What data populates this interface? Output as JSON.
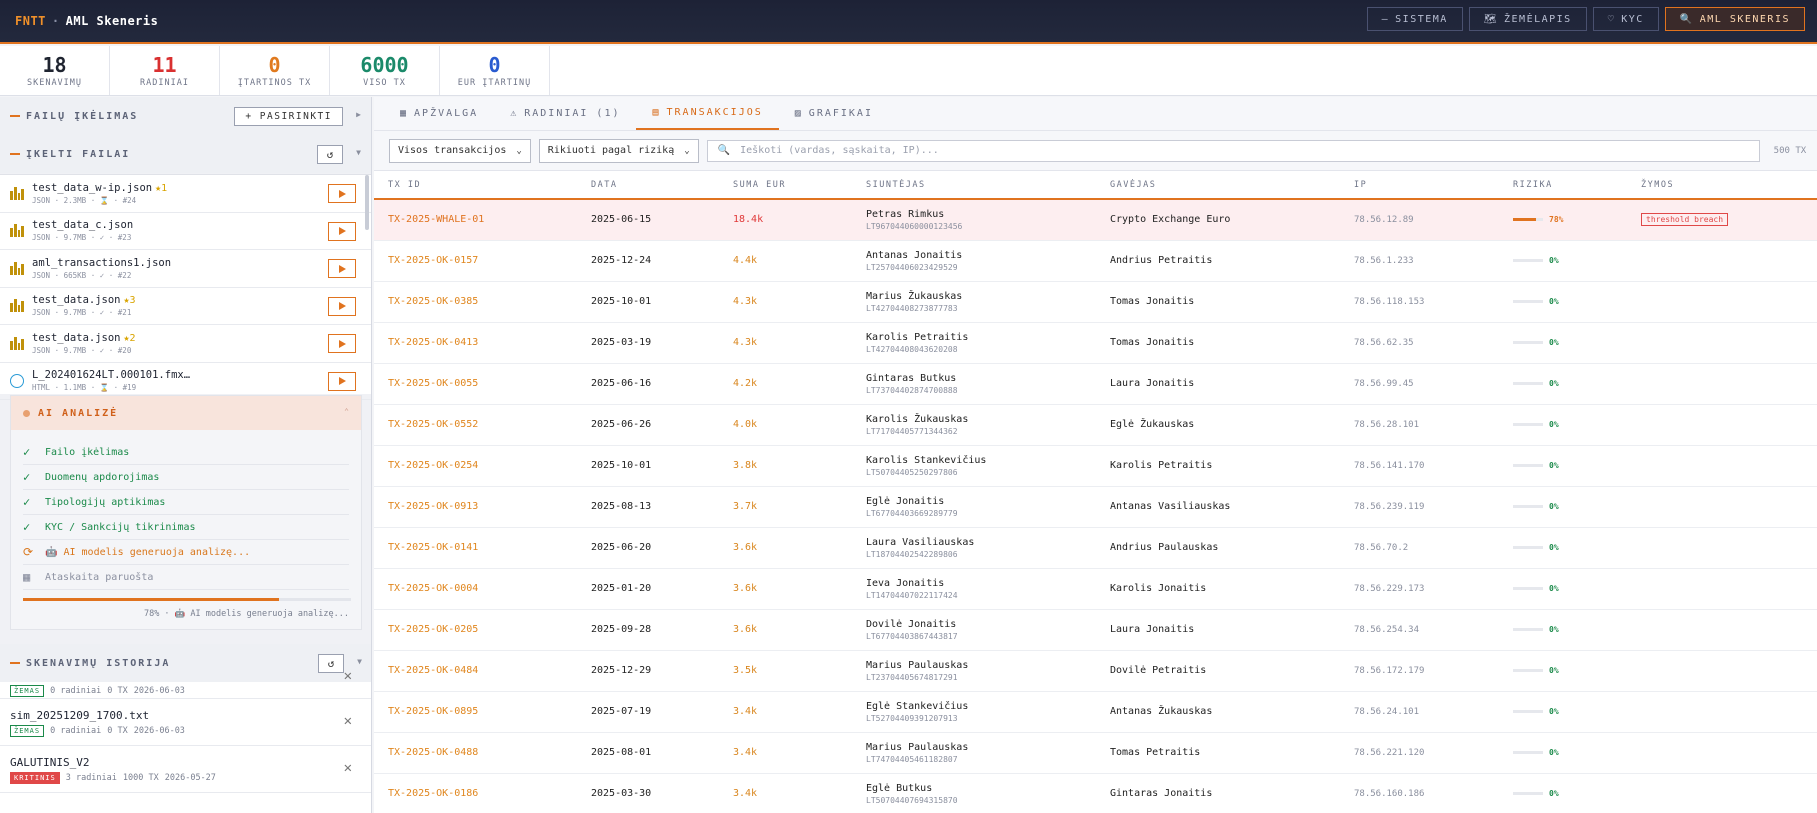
{
  "header": {
    "brand_code": "FNTT",
    "brand_sep": "·",
    "brand_title": "AML Skeneris",
    "nav": [
      {
        "icon": "—",
        "label": "SISTEMA"
      },
      {
        "icon": "🗺",
        "label": "ŽEMĖLAPIS"
      },
      {
        "icon": "♡",
        "label": "KYC"
      },
      {
        "icon": "🔍",
        "label": "AML SKENERIS"
      }
    ]
  },
  "stats": [
    {
      "value": "18",
      "label": "SKENAVIMŲ",
      "color": "#1f2430"
    },
    {
      "value": "11",
      "label": "RADINIAI",
      "color": "#d93030"
    },
    {
      "value": "0",
      "label": "ĮTARTINOS TX",
      "color": "#e07a1f"
    },
    {
      "value": "6000",
      "label": "VISO TX",
      "color": "#1b8a6a"
    },
    {
      "value": "0",
      "label": "EUR ĮTARTINŲ",
      "color": "#2a5bd0"
    }
  ],
  "left": {
    "upload_title": "FAILŲ ĮKĖLIMAS",
    "upload_button": "+ PASIRINKTI",
    "files_title": "ĮKELTI FAILAI",
    "refresh_icon": "↺",
    "files": [
      {
        "name": "test_data_w-ip.json",
        "star": "★1",
        "meta": "JSON · 2.3MB · ⌛ · #24",
        "icon": "bars"
      },
      {
        "name": "test_data_c.json",
        "star": "",
        "meta": "JSON · 9.7MB · ✓ · #23",
        "icon": "bars"
      },
      {
        "name": "aml_transactions1.json",
        "star": "",
        "meta": "JSON · 665KB · ✓ · #22",
        "icon": "bars"
      },
      {
        "name": "test_data.json",
        "star": "★3",
        "meta": "JSON · 9.7MB · ✓ · #21",
        "icon": "bars"
      },
      {
        "name": "test_data.json",
        "star": "★2",
        "meta": "JSON · 9.7MB · ✓ · #20",
        "icon": "bars"
      },
      {
        "name": "L_202401624LT.000101.fmx…",
        "star": "",
        "meta": "HTML · 1.1MB · ⌛ · #19",
        "icon": "globe"
      }
    ],
    "ai": {
      "title": "AI ANALIZĖ",
      "caret": "⌃",
      "steps": [
        {
          "icon": "✓",
          "label": "Failo įkėlimas",
          "state": "done"
        },
        {
          "icon": "✓",
          "label": "Duomenų apdorojimas",
          "state": "done"
        },
        {
          "icon": "✓",
          "label": "Tipologijų aptikimas",
          "state": "done"
        },
        {
          "icon": "✓",
          "label": "KYC / Sankcijų tikrinimas",
          "state": "done"
        },
        {
          "icon": "⟳",
          "label": "🤖 AI modelis generuoja analizę...",
          "state": "active"
        },
        {
          "icon": "▦",
          "label": "Ataskaita paruošta",
          "state": "pending"
        }
      ],
      "progress": 0.78,
      "progress_text": "78% · 🤖 AI modelis generuoja analizę..."
    },
    "history_title": "SKENAVIMŲ ISTORIJA",
    "history": [
      {
        "name": "",
        "badge": "ŽEMAS",
        "level": "low",
        "findings": "0 radiniai",
        "tx": "0 TX",
        "date": "2026-06-03"
      },
      {
        "name": "sim_20251209_1700.txt",
        "badge": "ŽEMAS",
        "level": "low",
        "findings": "0 radiniai",
        "tx": "0 TX",
        "date": "2026-06-03"
      },
      {
        "name": "GALUTINIS_V2",
        "badge": "KRITINIS",
        "level": "crit",
        "findings": "3 radiniai",
        "tx": "1000 TX",
        "date": "2026-05-27"
      }
    ]
  },
  "tabs": [
    {
      "icon": "▦",
      "label": "APŽVALGA",
      "active": false
    },
    {
      "icon": "⚠",
      "label": "RADINIAI (1)",
      "active": false
    },
    {
      "icon": "▤",
      "label": "TRANSAKCIJOS",
      "active": true
    },
    {
      "icon": "▨",
      "label": "GRAFIKAI",
      "active": false
    }
  ],
  "filters": {
    "type_select": "Visos transakcijos",
    "sort_select": "Rikiuoti pagal riziką",
    "search_placeholder": "Ieškoti (vardas, sąskaita, IP)...",
    "count": "500 TX"
  },
  "table": {
    "headers": [
      "TX ID",
      "DATA",
      "SUMA EUR",
      "SIUNTĖJAS",
      "GAVĖJAS",
      "IP",
      "RIZIKA",
      "ŽYMOS"
    ],
    "rows": [
      {
        "id": "TX-2025-WHALE-01",
        "date": "2025-06-15",
        "amount": "18.4k",
        "sender": "Petras Rimkus",
        "account": "LT967044060000123456",
        "receiver": "Crypto Exchange Euro",
        "ip": "78.56.12.89",
        "risk": 0.78,
        "risk_label": "78%",
        "tag": "threshold breach"
      },
      {
        "id": "TX-2025-OK-0157",
        "date": "2025-12-24",
        "amount": "4.4k",
        "sender": "Antanas Jonaitis",
        "account": "LT25704406023429529",
        "receiver": "Andrius Petraitis",
        "ip": "78.56.1.233",
        "risk": 0,
        "risk_label": "0%",
        "tag": ""
      },
      {
        "id": "TX-2025-OK-0385",
        "date": "2025-10-01",
        "amount": "4.3k",
        "sender": "Marius Žukauskas",
        "account": "LT42704408273877783",
        "receiver": "Tomas Jonaitis",
        "ip": "78.56.118.153",
        "risk": 0,
        "risk_label": "0%",
        "tag": ""
      },
      {
        "id": "TX-2025-OK-0413",
        "date": "2025-03-19",
        "amount": "4.3k",
        "sender": "Karolis Petraitis",
        "account": "LT42704408043620208",
        "receiver": "Tomas Jonaitis",
        "ip": "78.56.62.35",
        "risk": 0,
        "risk_label": "0%",
        "tag": ""
      },
      {
        "id": "TX-2025-OK-0055",
        "date": "2025-06-16",
        "amount": "4.2k",
        "sender": "Gintaras Butkus",
        "account": "LT73704402874700888",
        "receiver": "Laura Jonaitis",
        "ip": "78.56.99.45",
        "risk": 0,
        "risk_label": "0%",
        "tag": ""
      },
      {
        "id": "TX-2025-OK-0552",
        "date": "2025-06-26",
        "amount": "4.0k",
        "sender": "Karolis Žukauskas",
        "account": "LT71704405771344362",
        "receiver": "Eglė Žukauskas",
        "ip": "78.56.28.101",
        "risk": 0,
        "risk_label": "0%",
        "tag": ""
      },
      {
        "id": "TX-2025-OK-0254",
        "date": "2025-10-01",
        "amount": "3.8k",
        "sender": "Karolis Stankevičius",
        "account": "LT50704405250297806",
        "receiver": "Karolis Petraitis",
        "ip": "78.56.141.170",
        "risk": 0,
        "risk_label": "0%",
        "tag": ""
      },
      {
        "id": "TX-2025-OK-0913",
        "date": "2025-08-13",
        "amount": "3.7k",
        "sender": "Eglė Jonaitis",
        "account": "LT67704403669289779",
        "receiver": "Antanas Vasiliauskas",
        "ip": "78.56.239.119",
        "risk": 0,
        "risk_label": "0%",
        "tag": ""
      },
      {
        "id": "TX-2025-OK-0141",
        "date": "2025-06-20",
        "amount": "3.6k",
        "sender": "Laura Vasiliauskas",
        "account": "LT18704402542289806",
        "receiver": "Andrius Paulauskas",
        "ip": "78.56.70.2",
        "risk": 0,
        "risk_label": "0%",
        "tag": ""
      },
      {
        "id": "TX-2025-OK-0004",
        "date": "2025-01-20",
        "amount": "3.6k",
        "sender": "Ieva Jonaitis",
        "account": "LT14704407022117424",
        "receiver": "Karolis Jonaitis",
        "ip": "78.56.229.173",
        "risk": 0,
        "risk_label": "0%",
        "tag": ""
      },
      {
        "id": "TX-2025-OK-0205",
        "date": "2025-09-28",
        "amount": "3.6k",
        "sender": "Dovilė Jonaitis",
        "account": "LT67704403867443817",
        "receiver": "Laura Jonaitis",
        "ip": "78.56.254.34",
        "risk": 0,
        "risk_label": "0%",
        "tag": ""
      },
      {
        "id": "TX-2025-OK-0484",
        "date": "2025-12-29",
        "amount": "3.5k",
        "sender": "Marius Paulauskas",
        "account": "LT23704405674817291",
        "receiver": "Dovilė Petraitis",
        "ip": "78.56.172.179",
        "risk": 0,
        "risk_label": "0%",
        "tag": ""
      },
      {
        "id": "TX-2025-OK-0895",
        "date": "2025-07-19",
        "amount": "3.4k",
        "sender": "Eglė Stankevičius",
        "account": "LT52704409391207913",
        "receiver": "Antanas Žukauskas",
        "ip": "78.56.24.101",
        "risk": 0,
        "risk_label": "0%",
        "tag": ""
      },
      {
        "id": "TX-2025-OK-0488",
        "date": "2025-08-01",
        "amount": "3.4k",
        "sender": "Marius Paulauskas",
        "account": "LT74704405461182807",
        "receiver": "Tomas Petraitis",
        "ip": "78.56.221.120",
        "risk": 0,
        "risk_label": "0%",
        "tag": ""
      },
      {
        "id": "TX-2025-OK-0186",
        "date": "2025-03-30",
        "amount": "3.4k",
        "sender": "Eglė Butkus",
        "account": "LT50704407694315870",
        "receiver": "Gintaras Jonaitis",
        "ip": "78.56.160.186",
        "risk": 0,
        "risk_label": "0%",
        "tag": ""
      }
    ]
  }
}
